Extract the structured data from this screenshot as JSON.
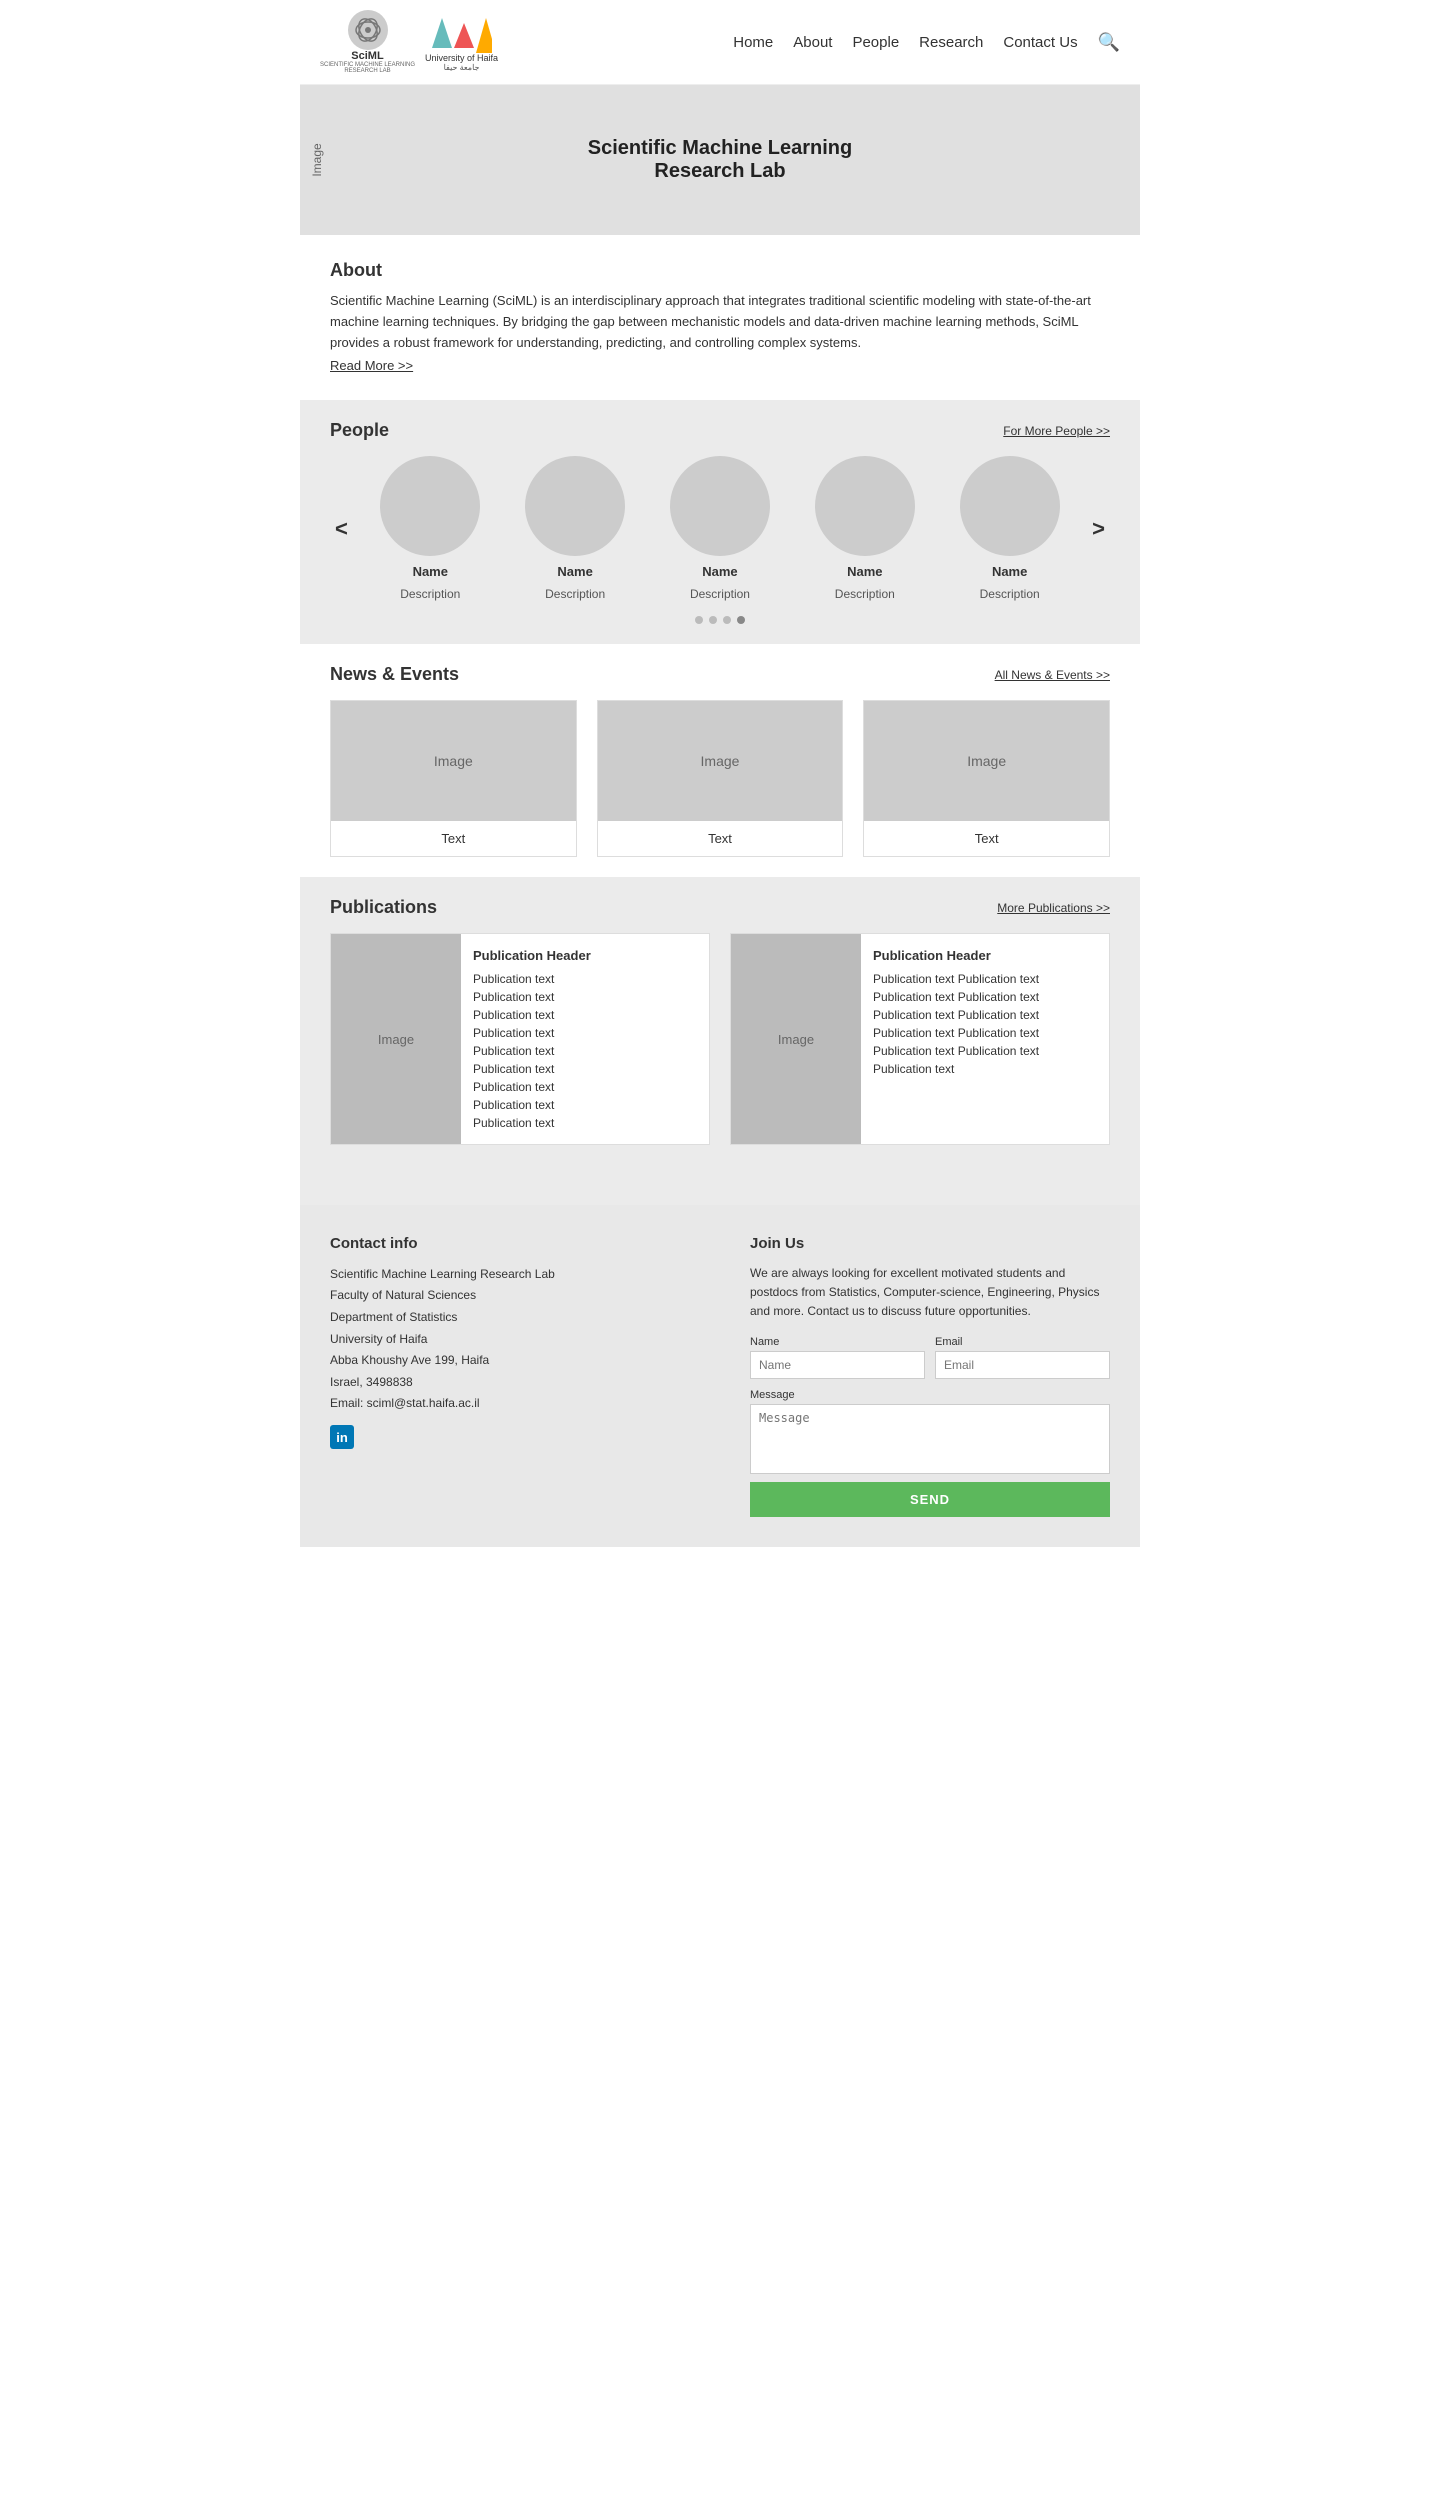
{
  "header": {
    "logo_sciml_text": "SciML",
    "logo_sciml_sub": "SCIENTIFIC MACHINE LEARNING\nRESEARCH LAB",
    "logo_haifa_text": "University of Haifa",
    "logo_haifa_arabic": "جامعة حيفا",
    "nav": {
      "items": [
        "Home",
        "About",
        "People",
        "Research",
        "Contact Us"
      ]
    }
  },
  "hero": {
    "image_label": "Image",
    "title": "Scientific Machine Learning",
    "title_line2": "Research Lab"
  },
  "about": {
    "title": "About",
    "text": "Scientific Machine Learning (SciML) is an interdisciplinary approach that integrates traditional scientific modeling with state-of-the-art machine learning techniques. By bridging the gap between mechanistic models and data-driven machine learning methods, SciML provides a robust framework for understanding, predicting, and controlling complex systems.",
    "read_more": "Read More >>"
  },
  "people": {
    "title": "People",
    "more_link": "For  More People >>",
    "prev_arrow": "<",
    "next_arrow": ">",
    "cards": [
      {
        "name": "Name",
        "description": "Description"
      },
      {
        "name": "Name",
        "description": "Description"
      },
      {
        "name": "Name",
        "description": "Description"
      },
      {
        "name": "Name",
        "description": "Description"
      },
      {
        "name": "Name",
        "description": "Description"
      }
    ],
    "dots": [
      false,
      false,
      false,
      true
    ]
  },
  "news": {
    "title": "News & Events",
    "more_link": "All News & Events >>",
    "cards": [
      {
        "image_label": "Image",
        "text": "Text"
      },
      {
        "image_label": "Image",
        "text": "Text"
      },
      {
        "image_label": "Image",
        "text": "Text"
      }
    ]
  },
  "publications": {
    "title": "Publications",
    "more_link": "More Publications >>",
    "cards": [
      {
        "image_label": "Image",
        "header": "Publication Header",
        "lines": [
          "Publication text",
          "Publication text",
          "Publication text",
          "Publication text",
          "Publication text",
          "Publication text",
          "Publication text",
          "Publication text",
          "Publication text"
        ]
      },
      {
        "image_label": "Image",
        "header": "Publication Header",
        "lines": [
          "Publication text Publication text",
          "Publication text Publication text",
          "Publication text Publication text",
          "Publication text Publication text",
          "Publication text Publication text",
          "Publication text"
        ]
      }
    ]
  },
  "footer": {
    "contact": {
      "title": "Contact info",
      "lines": [
        "Scientific Machine Learning Research Lab",
        "Faculty of Natural Sciences",
        "Department of Statistics",
        "University of Haifa",
        "Abba Khoushy Ave 199, Haifa",
        "Israel, 3498838",
        "Email: sciml@stat.haifa.ac.il"
      ],
      "linkedin_label": "in"
    },
    "join": {
      "title": "Join Us",
      "text": "We are always looking for excellent motivated students and postdocs from Statistics, Computer-science, Engineering, Physics and more. Contact us to discuss future opportunities.",
      "name_label": "Name",
      "name_placeholder": "Name",
      "email_label": "Email",
      "email_placeholder": "Email",
      "message_label": "Message",
      "message_placeholder": "Message",
      "send_label": "SEND"
    }
  }
}
